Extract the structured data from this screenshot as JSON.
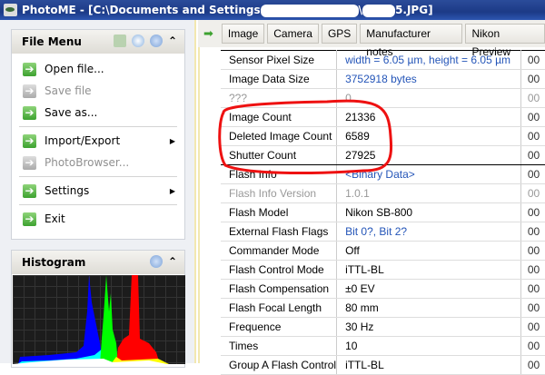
{
  "window": {
    "title_prefix": "PhotoME - [C:\\Documents and Settings",
    "title_mid": "\\",
    "title_suffix": "5.JPG]"
  },
  "file_menu": {
    "title": "File Menu",
    "items": [
      {
        "label": "Open file...",
        "enabled": true
      },
      {
        "label": "Save file",
        "enabled": false
      },
      {
        "label": "Save as...",
        "enabled": true
      },
      {
        "label": "Import/Export",
        "enabled": true,
        "submenu": true
      },
      {
        "label": "PhotoBrowser...",
        "enabled": false
      },
      {
        "label": "Settings",
        "enabled": true,
        "submenu": true
      },
      {
        "label": "Exit",
        "enabled": true
      }
    ]
  },
  "histogram": {
    "title": "Histogram"
  },
  "tabs": [
    "Image",
    "Camera",
    "GPS",
    "Manufacturer notes",
    "Nikon Preview"
  ],
  "rows": [
    {
      "label": "Sensor Pixel Size",
      "value": "width = 6.05 µm, height = 6.05 µm",
      "code": "00",
      "style": "blue"
    },
    {
      "label": "Image Data Size",
      "value": "3752918 bytes",
      "code": "00",
      "style": "blue"
    },
    {
      "label": "???",
      "value": "0",
      "code": "00",
      "style": "gray"
    },
    {
      "label": "Image Count",
      "value": "21336",
      "code": "00",
      "style": ""
    },
    {
      "label": "Deleted Image Count",
      "value": "6589",
      "code": "00",
      "style": ""
    },
    {
      "label": "Shutter Count",
      "value": "27925",
      "code": "00",
      "style": ""
    },
    {
      "label": "Flash Info",
      "value": "<Binary Data>",
      "code": "00",
      "style": "blue"
    },
    {
      "label": "Flash Info Version",
      "value": "1.0.1",
      "code": "00",
      "style": "gray"
    },
    {
      "label": "Flash Model",
      "value": "Nikon SB-800",
      "code": "00",
      "style": ""
    },
    {
      "label": "External Flash Flags",
      "value": "Bit 0?, Bit 2?",
      "code": "00",
      "style": "blue"
    },
    {
      "label": "Commander Mode",
      "value": "Off",
      "code": "00",
      "style": ""
    },
    {
      "label": "Flash Control Mode",
      "value": "iTTL-BL",
      "code": "00",
      "style": ""
    },
    {
      "label": "Flash Compensation",
      "value": "±0 EV",
      "code": "00",
      "style": ""
    },
    {
      "label": "Flash Focal Length",
      "value": "80 mm",
      "code": "00",
      "style": ""
    },
    {
      "label": "Frequence",
      "value": "30 Hz",
      "code": "00",
      "style": ""
    },
    {
      "label": "Times",
      "value": "10",
      "code": "00",
      "style": ""
    },
    {
      "label": "Group A Flash Control",
      "value": "iTTL-BL",
      "code": "00",
      "style": ""
    }
  ],
  "annotation_color": "#ee1111"
}
